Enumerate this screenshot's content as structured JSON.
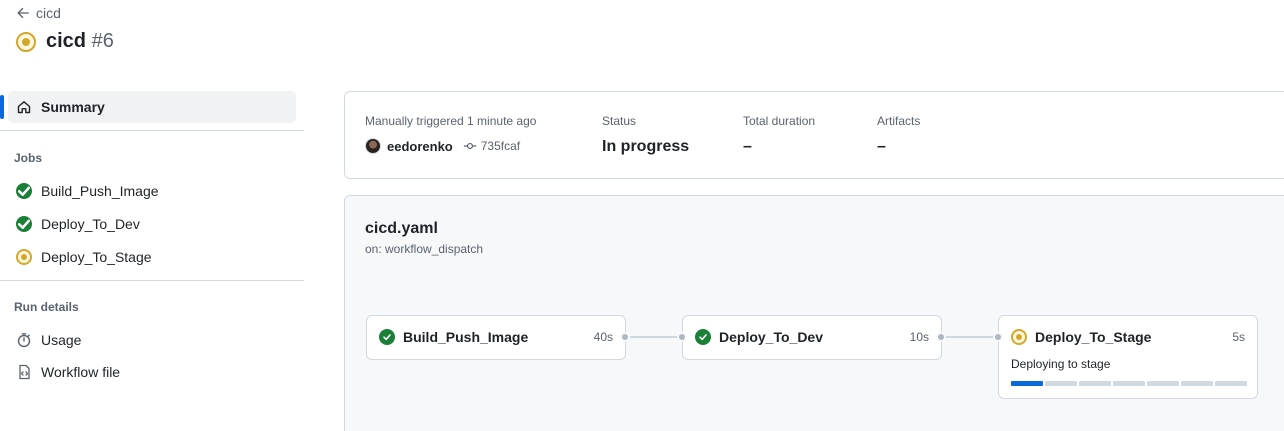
{
  "back": {
    "label": "cicd"
  },
  "run": {
    "name": "cicd",
    "number": "#6"
  },
  "sidebar": {
    "summary_label": "Summary",
    "jobs_heading": "Jobs",
    "jobs": [
      {
        "label": "Build_Push_Image",
        "status": "success"
      },
      {
        "label": "Deploy_To_Dev",
        "status": "success"
      },
      {
        "label": "Deploy_To_Stage",
        "status": "in_progress"
      }
    ],
    "run_details_heading": "Run details",
    "details": [
      {
        "label": "Usage",
        "icon": "stopwatch-icon"
      },
      {
        "label": "Workflow file",
        "icon": "file-code-icon"
      }
    ]
  },
  "summary": {
    "trigger_label": "Manually triggered 1 minute ago",
    "actor": "eedorenko",
    "commit": "735fcaf",
    "status_label": "Status",
    "status_value": "In progress",
    "duration_label": "Total duration",
    "duration_value": "–",
    "artifacts_label": "Artifacts",
    "artifacts_value": "–"
  },
  "workflow": {
    "file": "cicd.yaml",
    "trigger": "on: workflow_dispatch",
    "jobs": [
      {
        "name": "Build_Push_Image",
        "duration": "40s",
        "status": "success"
      },
      {
        "name": "Deploy_To_Dev",
        "duration": "10s",
        "status": "success"
      },
      {
        "name": "Deploy_To_Stage",
        "duration": "5s",
        "status": "in_progress",
        "step": "Deploying to stage",
        "progress_segments_done": 1,
        "progress_segments_total": 7
      }
    ]
  },
  "colors": {
    "success": "#1a7f37",
    "in_progress": "#d4a72c",
    "accent": "#0969da"
  }
}
